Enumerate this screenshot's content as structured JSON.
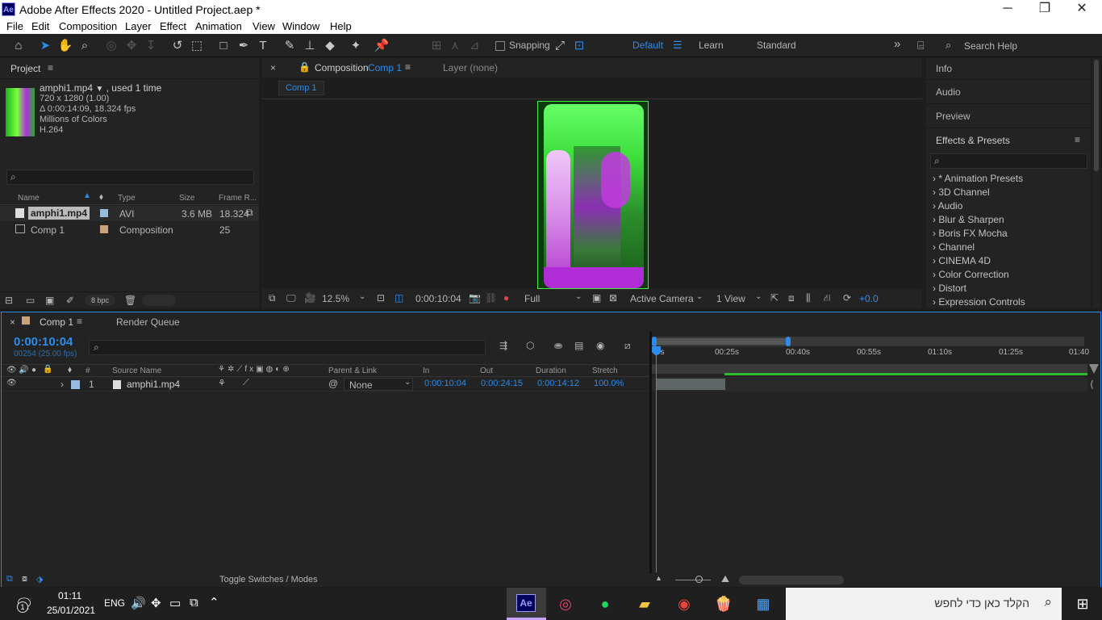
{
  "window": {
    "title": "Adobe After Effects 2020 - Untitled Project.aep *",
    "logo": "Ae",
    "min": "─",
    "max": "❐",
    "close": "✕"
  },
  "menu": [
    "File",
    "Edit",
    "Composition",
    "Layer",
    "Effect",
    "Animation",
    "View",
    "Window",
    "Help"
  ],
  "toolbar": {
    "snapping_label": "Snapping",
    "workspaces": [
      "Default",
      "Learn",
      "Standard"
    ],
    "search_placeholder": "Search Help",
    "more": "»"
  },
  "project": {
    "tab_label": "Project",
    "file": {
      "name": "amphi1.mp4",
      "used": ", used 1 time",
      "dims": "720 x 1280 (1.00)",
      "duration": "Δ 0:00:14:09, 18.324 fps",
      "colors": "Millions of Colors",
      "codec": "H.264"
    },
    "columns": [
      "Name",
      "Type",
      "Size",
      "Frame R..."
    ],
    "items": [
      {
        "name": "amphi1.mp4",
        "type": "AVI",
        "size": "3.6 MB",
        "fps": "18.324"
      },
      {
        "name": "Comp 1",
        "type": "Composition",
        "size": "",
        "fps": "25"
      }
    ],
    "bpc": "8 bpc"
  },
  "composition": {
    "tab_label": "Composition",
    "tab_comp": "Comp 1",
    "layer_tab": "Layer (none)",
    "subtab": "Comp 1",
    "zoom": "12.5%",
    "timecode": "0:00:10:04",
    "resolution": "Full",
    "camera": "Active Camera",
    "views": "1 View",
    "exposure": "+0.0"
  },
  "right_panels": {
    "info": "Info",
    "audio": "Audio",
    "preview": "Preview",
    "effects_title": "Effects & Presets",
    "effects": [
      "* Animation Presets",
      "3D Channel",
      "Audio",
      "Blur & Sharpen",
      "Boris FX Mocha",
      "Channel",
      "CINEMA 4D",
      "Color Correction",
      "Distort",
      "Expression Controls"
    ]
  },
  "timeline": {
    "tab_label": "Comp 1",
    "render_queue": "Render Queue",
    "current_time": "0:00:10:04",
    "frames_fps": "00254 (25.00 fps)",
    "columns": {
      "num": "#",
      "source": "Source Name",
      "parent": "Parent & Link",
      "in": "In",
      "out": "Out",
      "duration": "Duration",
      "stretch": "Stretch"
    },
    "ruler": [
      "0s",
      "00:25s",
      "00:40s",
      "00:55s",
      "01:10s",
      "01:25s",
      "01:40"
    ],
    "layer": {
      "num": "1",
      "name": "amphi1.mp4",
      "parent": "None",
      "in": "0:00:10:04",
      "out": "0:00:24:15",
      "duration": "0:00:14:12",
      "stretch": "100.0%"
    },
    "toggle_label": "Toggle Switches / Modes"
  },
  "taskbar": {
    "time": "01:11",
    "date": "25/01/2021",
    "lang": "ENG",
    "search_text": "הקלד כאן כדי לחפש",
    "notif": "1"
  }
}
